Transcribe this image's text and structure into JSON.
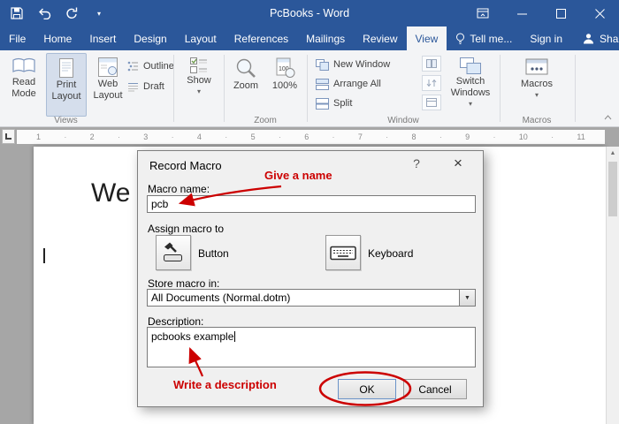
{
  "titlebar": {
    "title": "PcBooks - Word"
  },
  "tabs": {
    "file": "File",
    "items": [
      "Home",
      "Insert",
      "Design",
      "Layout",
      "References",
      "Mailings",
      "Review",
      "View"
    ],
    "tell_me": "Tell me...",
    "sign_in": "Sign in",
    "share": "Share"
  },
  "ribbon": {
    "views": {
      "read_mode": "Read Mode",
      "print_layout": "Print Layout",
      "web_layout": "Web Layout",
      "outline": "Outline",
      "draft": "Draft",
      "label": "Views"
    },
    "show": {
      "label": "Show"
    },
    "zoom": {
      "zoom": "Zoom",
      "hundred": "100%",
      "label": "Zoom"
    },
    "window": {
      "new_window": "New Window",
      "arrange_all": "Arrange All",
      "split": "Split",
      "switch_windows": "Switch Windows",
      "label": "Window"
    },
    "macros": {
      "button": "Macros",
      "label": "Macros"
    }
  },
  "ruler": {
    "numbers": [
      "1",
      "2",
      "3",
      "4",
      "5",
      "6",
      "7",
      "8",
      "9",
      "10",
      "11"
    ]
  },
  "document": {
    "text": "We"
  },
  "dialog": {
    "title": "Record Macro",
    "macro_name_label": "Macro name:",
    "macro_name_value": "pcb",
    "assign_label": "Assign macro to",
    "button_label": "Button",
    "keyboard_label": "Keyboard",
    "store_label": "Store macro in:",
    "store_value": "All Documents (Normal.dotm)",
    "description_label": "Description:",
    "description_value": "pcbooks example",
    "ok": "OK",
    "cancel": "Cancel"
  },
  "annotations": {
    "give_a_name": "Give a name",
    "write_a_description": "Write a description",
    "color": "#cc0000"
  },
  "glyphs": {
    "dropdown_arrow": "▾",
    "combo_arrow": "▼",
    "help": "?",
    "close": "×",
    "scroll_up": "▲",
    "ruler_dot": "·"
  },
  "colors": {
    "titlebar": "#2b579a",
    "ribbon_bg": "#f3f4f6",
    "selected_button": "#d5deec",
    "annotation": "#cc0000"
  }
}
